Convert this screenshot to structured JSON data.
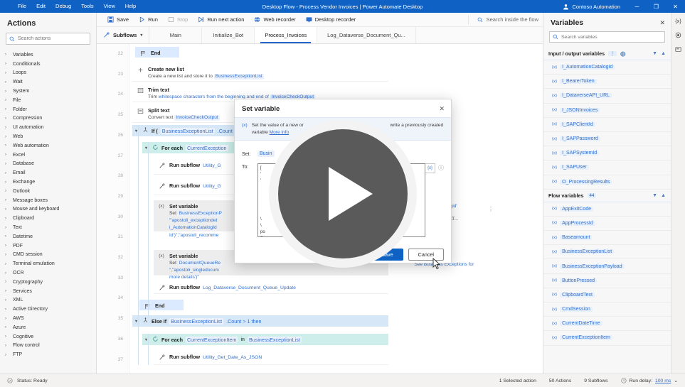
{
  "window": {
    "title": "Desktop Flow - Process Vendor Invoices | Power Automate Desktop",
    "account": "Contoso Automation",
    "minimize": "─",
    "maximize": "❐",
    "close": "✕",
    "menus": [
      "File",
      "Edit",
      "Debug",
      "Tools",
      "View",
      "Help"
    ]
  },
  "actions_pane": {
    "title": "Actions",
    "search_placeholder": "Search actions",
    "search_value": "",
    "categories": [
      "Variables",
      "Conditionals",
      "Loops",
      "Wait",
      "System",
      "File",
      "Folder",
      "Compression",
      "UI automation",
      "Web",
      "Web automation",
      "Excel",
      "Database",
      "Email",
      "Exchange",
      "Outlook",
      "Message boxes",
      "Mouse and keyboard",
      "Clipboard",
      "Text",
      "Datetime",
      "PDF",
      "CMD session",
      "Terminal emulation",
      "OCR",
      "Cryptography",
      "Services",
      "XML",
      "Active Directory",
      "AWS",
      "Azure",
      "Cognitive",
      "Flow control",
      "FTP"
    ]
  },
  "toolbar": {
    "save": "Save",
    "run": "Run",
    "stop": "Stop",
    "run_next_action": "Run next action",
    "web_recorder": "Web recorder",
    "desktop_recorder": "Desktop recorder",
    "flow_search_placeholder": "Search inside the flow"
  },
  "tabs": {
    "subflows_label": "Subflows",
    "items": [
      {
        "label": "Main",
        "active": false
      },
      {
        "label": "Initialize_Bot",
        "active": false
      },
      {
        "label": "Process_Invoices",
        "active": true
      },
      {
        "label": "Log_Dataverse_Document_Qu...",
        "active": false
      }
    ]
  },
  "canvas": {
    "line_numbers": [
      22,
      23,
      24,
      25,
      26,
      27,
      28,
      29,
      30,
      31,
      32,
      33,
      34,
      35,
      36,
      37
    ],
    "rows": [
      {
        "kind": "end",
        "name": "End",
        "icon": "flag-icon"
      },
      {
        "kind": "action",
        "name": "Create new list",
        "icon": "plus-icon",
        "desc_pre": "Create a new list and store it to ",
        "chip": "BusinessExceptionList",
        "desc_post": ""
      },
      {
        "kind": "action",
        "name": "Trim text",
        "icon": "text-icon",
        "desc_pre": "Trim ",
        "desc_mid": "whitespace characters from the beginning and end of ",
        "chip": "InvoiceCheckOutput",
        "desc_post": ""
      },
      {
        "kind": "action",
        "name": "Split text",
        "icon": "text-icon",
        "desc_pre": "Convert text ",
        "chip": "InvoiceCheckOutput",
        "desc_post": ""
      },
      {
        "kind": "if",
        "name": "If (",
        "chip": "BusinessExceptionList",
        "suffix": ".Count",
        "icon": "condition-icon"
      },
      {
        "kind": "foreach",
        "name": "For each",
        "chip": "CurrentException",
        "icon": "loop-icon"
      },
      {
        "kind": "subflow",
        "name": "Run subflow",
        "chip": "Utility_G",
        "icon": "subflow-icon"
      },
      {
        "kind": "subflow",
        "name": "Run subflow",
        "chip": "Utility_G",
        "icon": "subflow-icon"
      },
      {
        "kind": "setvar",
        "name": "Set variable",
        "icon": "setvar-icon",
        "desc_pre": "Set  ",
        "chip": "BusinessExceptionP",
        "line2": "\"'apostoli_exceptiondet",
        "line3": "i_AutomationCatalogId",
        "line4": "Id')\",\"apostoli_recomme"
      },
      {
        "kind": "setvar",
        "name": "Set variable",
        "icon": "setvar-icon",
        "desc_pre": "Set  ",
        "chip": "DocumentQueueRe",
        "line2": "\",\"apostoli_singledocum",
        "line3": "more details')\""
      },
      {
        "kind": "subflow",
        "name": "Run subflow",
        "chip": "Log_Dataverse_Document_Queue_Update",
        "icon": "subflow-icon"
      },
      {
        "kind": "end",
        "name": "End",
        "icon": "flag-icon"
      },
      {
        "kind": "elseif",
        "name": "Else if",
        "chip": "BusinessExceptionList",
        "suffix": ".Count > 1 then",
        "icon": "condition-icon"
      },
      {
        "kind": "foreach",
        "name": "For each",
        "chip": "CurrentExceptionItem",
        "mid": "in",
        "chip2": "BusinessExceptionList",
        "icon": "loop-icon"
      },
      {
        "kind": "subflow",
        "name": "Run subflow",
        "chip": "Utility_Get_Date_As_JSON",
        "icon": "subflow-icon"
      }
    ],
    "fragments": {
      "right1": "i_automationcatalogid'",
      "right2": "er changing the VAT...",
      "right3": "\"See Business Exceptions for"
    }
  },
  "variables_pane": {
    "title": "Variables",
    "close": "✕",
    "search_placeholder": "Search variables",
    "search_value": "",
    "sections": [
      {
        "title": "Input / output variables",
        "count": "",
        "items": [
          "I_AutomationCatalogId",
          "I_BearerToken",
          "I_DataverseAPI_URL",
          "I_JSONInvoices",
          "I_SAPClientId",
          "I_SAPPassword",
          "I_SAPSystemId",
          "I_SAPUser",
          "O_ProcessingResults"
        ]
      },
      {
        "title": "Flow variables",
        "count": "44",
        "items": [
          "AppExitCode",
          "AppProcessId",
          "Baseamount",
          "BusinessExceptionList",
          "BusinessExceptionPayload",
          "ButtonPressed",
          "ClipboardText",
          "CmdSession",
          "CurrentDateTime",
          "CurrentExceptionItem"
        ]
      }
    ],
    "var_badge": "{x}",
    "rail_icons": [
      "variables-rail-icon",
      "recorder-rail-icon",
      "ui-elements-rail-icon"
    ]
  },
  "modal": {
    "title": "Set variable",
    "close": "✕",
    "info_icon": "(x)",
    "info_text_a": "Set the value of a new or",
    "info_text_b": "write a previously created",
    "info_text_c": "variable",
    "info_link": "More info",
    "set_label": "Set:",
    "set_value": "Busin",
    "to_label": "To:",
    "to_value": "[\n'\n'\n\n\n\n\n\n\\\n\\\npo\nPay\nEscap",
    "fx_badge": "{x}",
    "save_label": "Save",
    "cancel_label": "Cancel"
  },
  "statusbar": {
    "status": "Status: Ready",
    "selected": "1 Selected action",
    "actions": "50 Actions",
    "subflows": "9 Subflows",
    "run_delay_label": "Run delay:",
    "run_delay_value": "100 ms",
    "chevron": "⌄"
  },
  "overlay": {
    "play": "play-button-overlay"
  }
}
